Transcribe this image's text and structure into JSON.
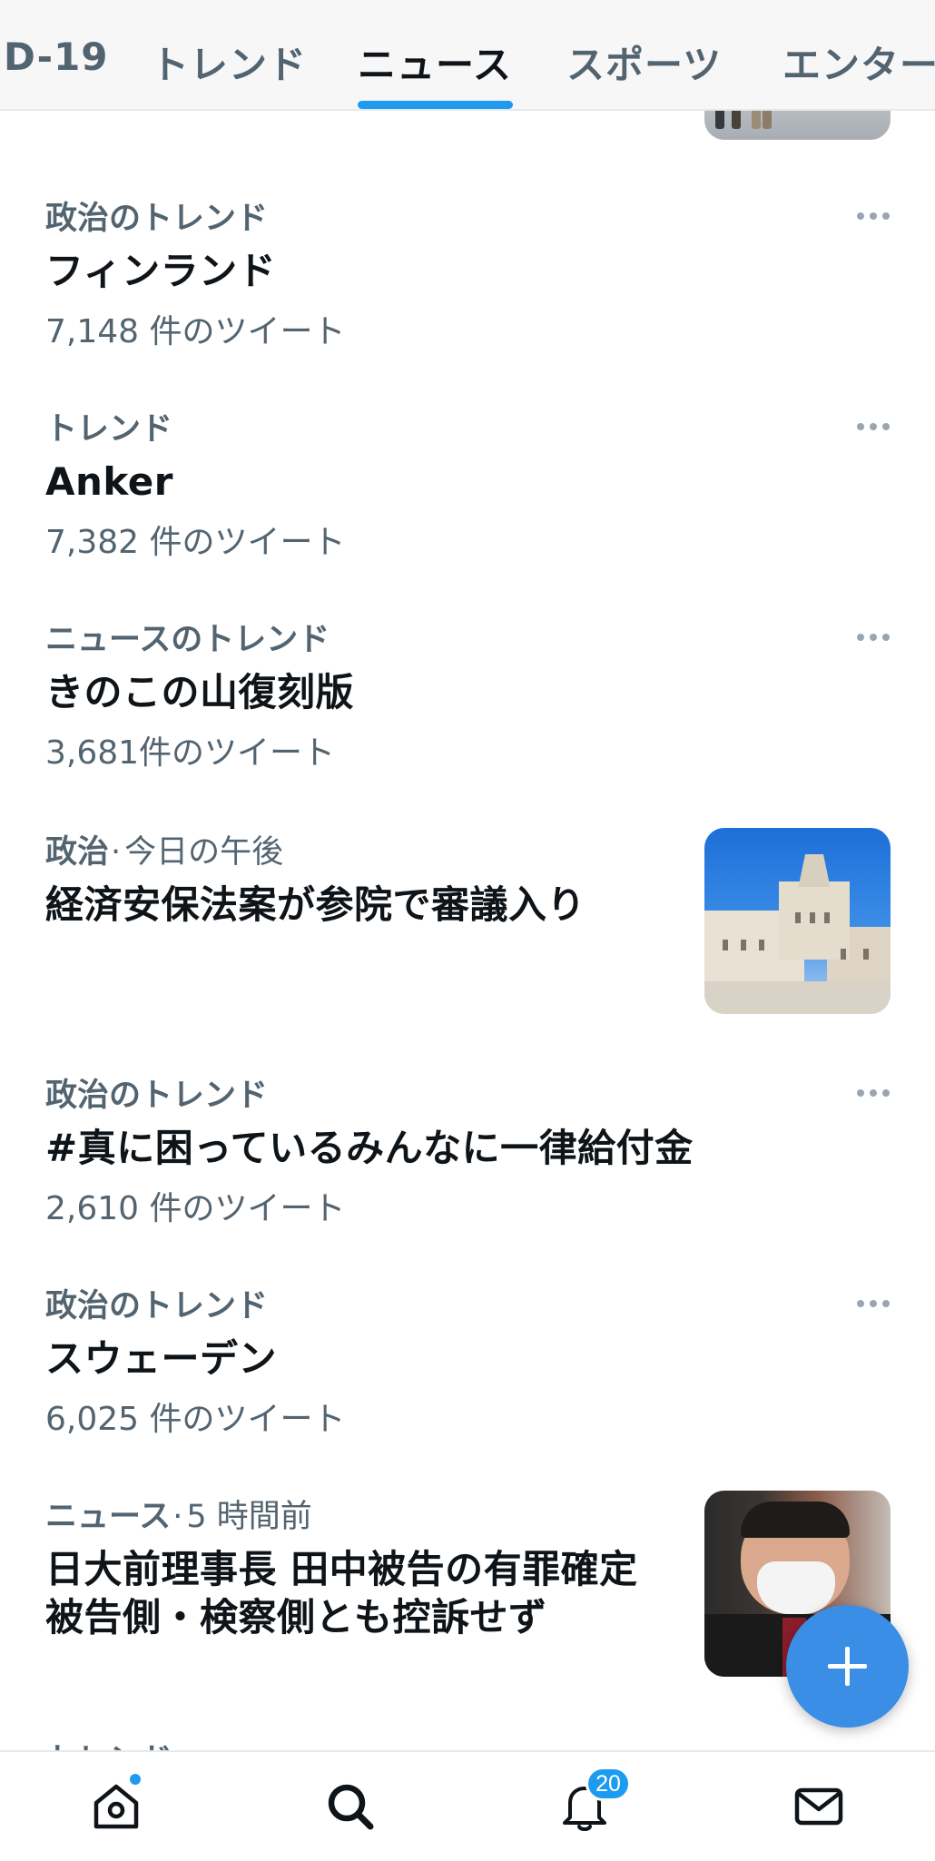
{
  "tabs": [
    {
      "label": "D-19",
      "active": false
    },
    {
      "label": "トレンド",
      "active": false
    },
    {
      "label": "ニュース",
      "active": true
    },
    {
      "label": "スポーツ",
      "active": false
    },
    {
      "label": "エンター",
      "active": false
    }
  ],
  "feed": [
    {
      "category": "政治のトレンド",
      "title": "フィンランド",
      "count": "7,148 件のツイート"
    },
    {
      "category": "トレンド",
      "title": "Anker",
      "count": "7,382 件のツイート"
    },
    {
      "category": "ニュースのトレンド",
      "title": "きのこの山復刻版",
      "count": "3,681件のツイート"
    },
    {
      "category": "政治",
      "time": "今日の午後",
      "title": "経済安保法案が参院で審議入り",
      "image": "diet-building-photo"
    },
    {
      "category": "政治のトレンド",
      "title": "#真に困っているみんなに一律給付金",
      "count": "2,610 件のツイート"
    },
    {
      "category": "政治のトレンド",
      "title": "スウェーデン",
      "count": "6,025 件のツイート"
    },
    {
      "category": "ニュース",
      "time": "5 時間前",
      "title_line1": "日大前理事長 田中被告の有罪確定",
      "title_line2": "被告側・検察側とも控訴せず",
      "image": "person-in-mask-photo"
    }
  ],
  "peek_label": "トレンド",
  "nav": {
    "home_icon": "home-icon",
    "search_icon": "search-icon",
    "notifications_icon": "bell-icon",
    "notifications_badge": "20",
    "messages_icon": "mail-icon"
  },
  "fab_icon": "plus-icon",
  "colors": {
    "accent": "#1d9bf0",
    "fab": "#3a8ee6",
    "text_primary": "#0f1419",
    "text_secondary": "#536471"
  }
}
